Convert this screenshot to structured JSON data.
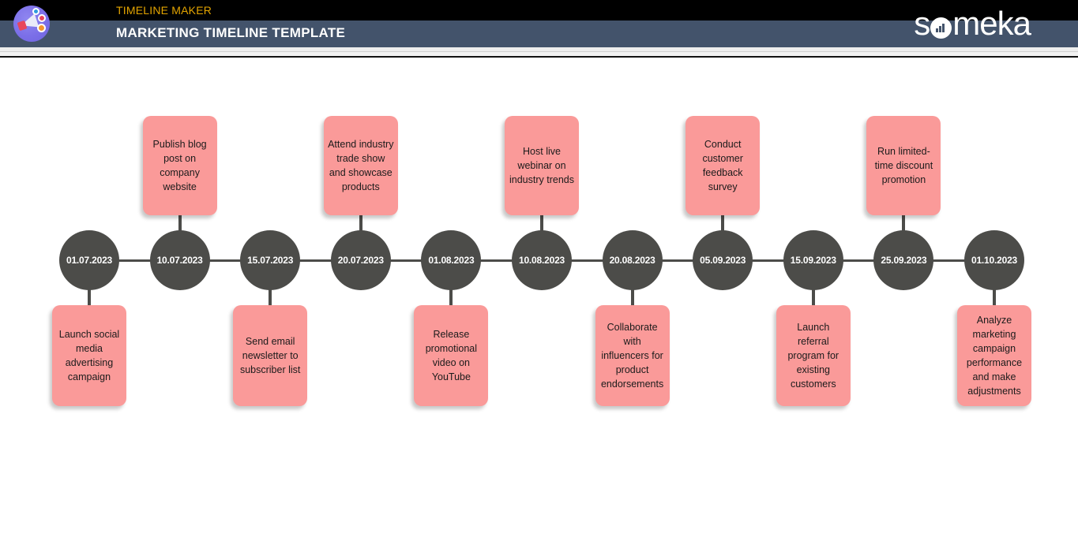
{
  "header": {
    "eyebrow": "TIMELINE MAKER",
    "title": "MARKETING TIMELINE TEMPLATE",
    "brand": {
      "name": "someka",
      "part_before_o": "s",
      "part_after_o": "meka",
      "logo_icon": "megaphone-icon",
      "badge_icon": "bar-chart-icon"
    },
    "colors": {
      "eyebrow": "#e3a400",
      "band_black": "#000000",
      "band_slate": "#43536b",
      "title": "#ffffff"
    }
  },
  "theme": {
    "node_color": "#4c4c49",
    "card_color": "#fa9a99",
    "card_text_color": "#1b1b1b",
    "node_text_color": "#ffffff",
    "background": "#ffffff"
  },
  "timeline": {
    "orientation": "horizontal",
    "milestone_count": 11,
    "milestones": [
      {
        "date": "01.07.2023",
        "position": "below",
        "text": "Launch social media advertising campaign"
      },
      {
        "date": "10.07.2023",
        "position": "above",
        "text": "Publish blog post on company website"
      },
      {
        "date": "15.07.2023",
        "position": "below",
        "text": "Send email newsletter to subscriber list"
      },
      {
        "date": "20.07.2023",
        "position": "above",
        "text": "Attend industry trade show and showcase products"
      },
      {
        "date": "01.08.2023",
        "position": "below",
        "text": "Release promotional video on YouTube"
      },
      {
        "date": "10.08.2023",
        "position": "above",
        "text": "Host live webinar on industry trends"
      },
      {
        "date": "20.08.2023",
        "position": "below",
        "text": "Collaborate with influencers for product endorsements"
      },
      {
        "date": "05.09.2023",
        "position": "above",
        "text": "Conduct customer feedback survey"
      },
      {
        "date": "15.09.2023",
        "position": "below",
        "text": "Launch referral program for existing customers"
      },
      {
        "date": "25.09.2023",
        "position": "above",
        "text": "Run limited-time discount promotion"
      },
      {
        "date": "01.10.2023",
        "position": "below",
        "text": "Analyze marketing campaign performance and make adjustments"
      }
    ]
  }
}
